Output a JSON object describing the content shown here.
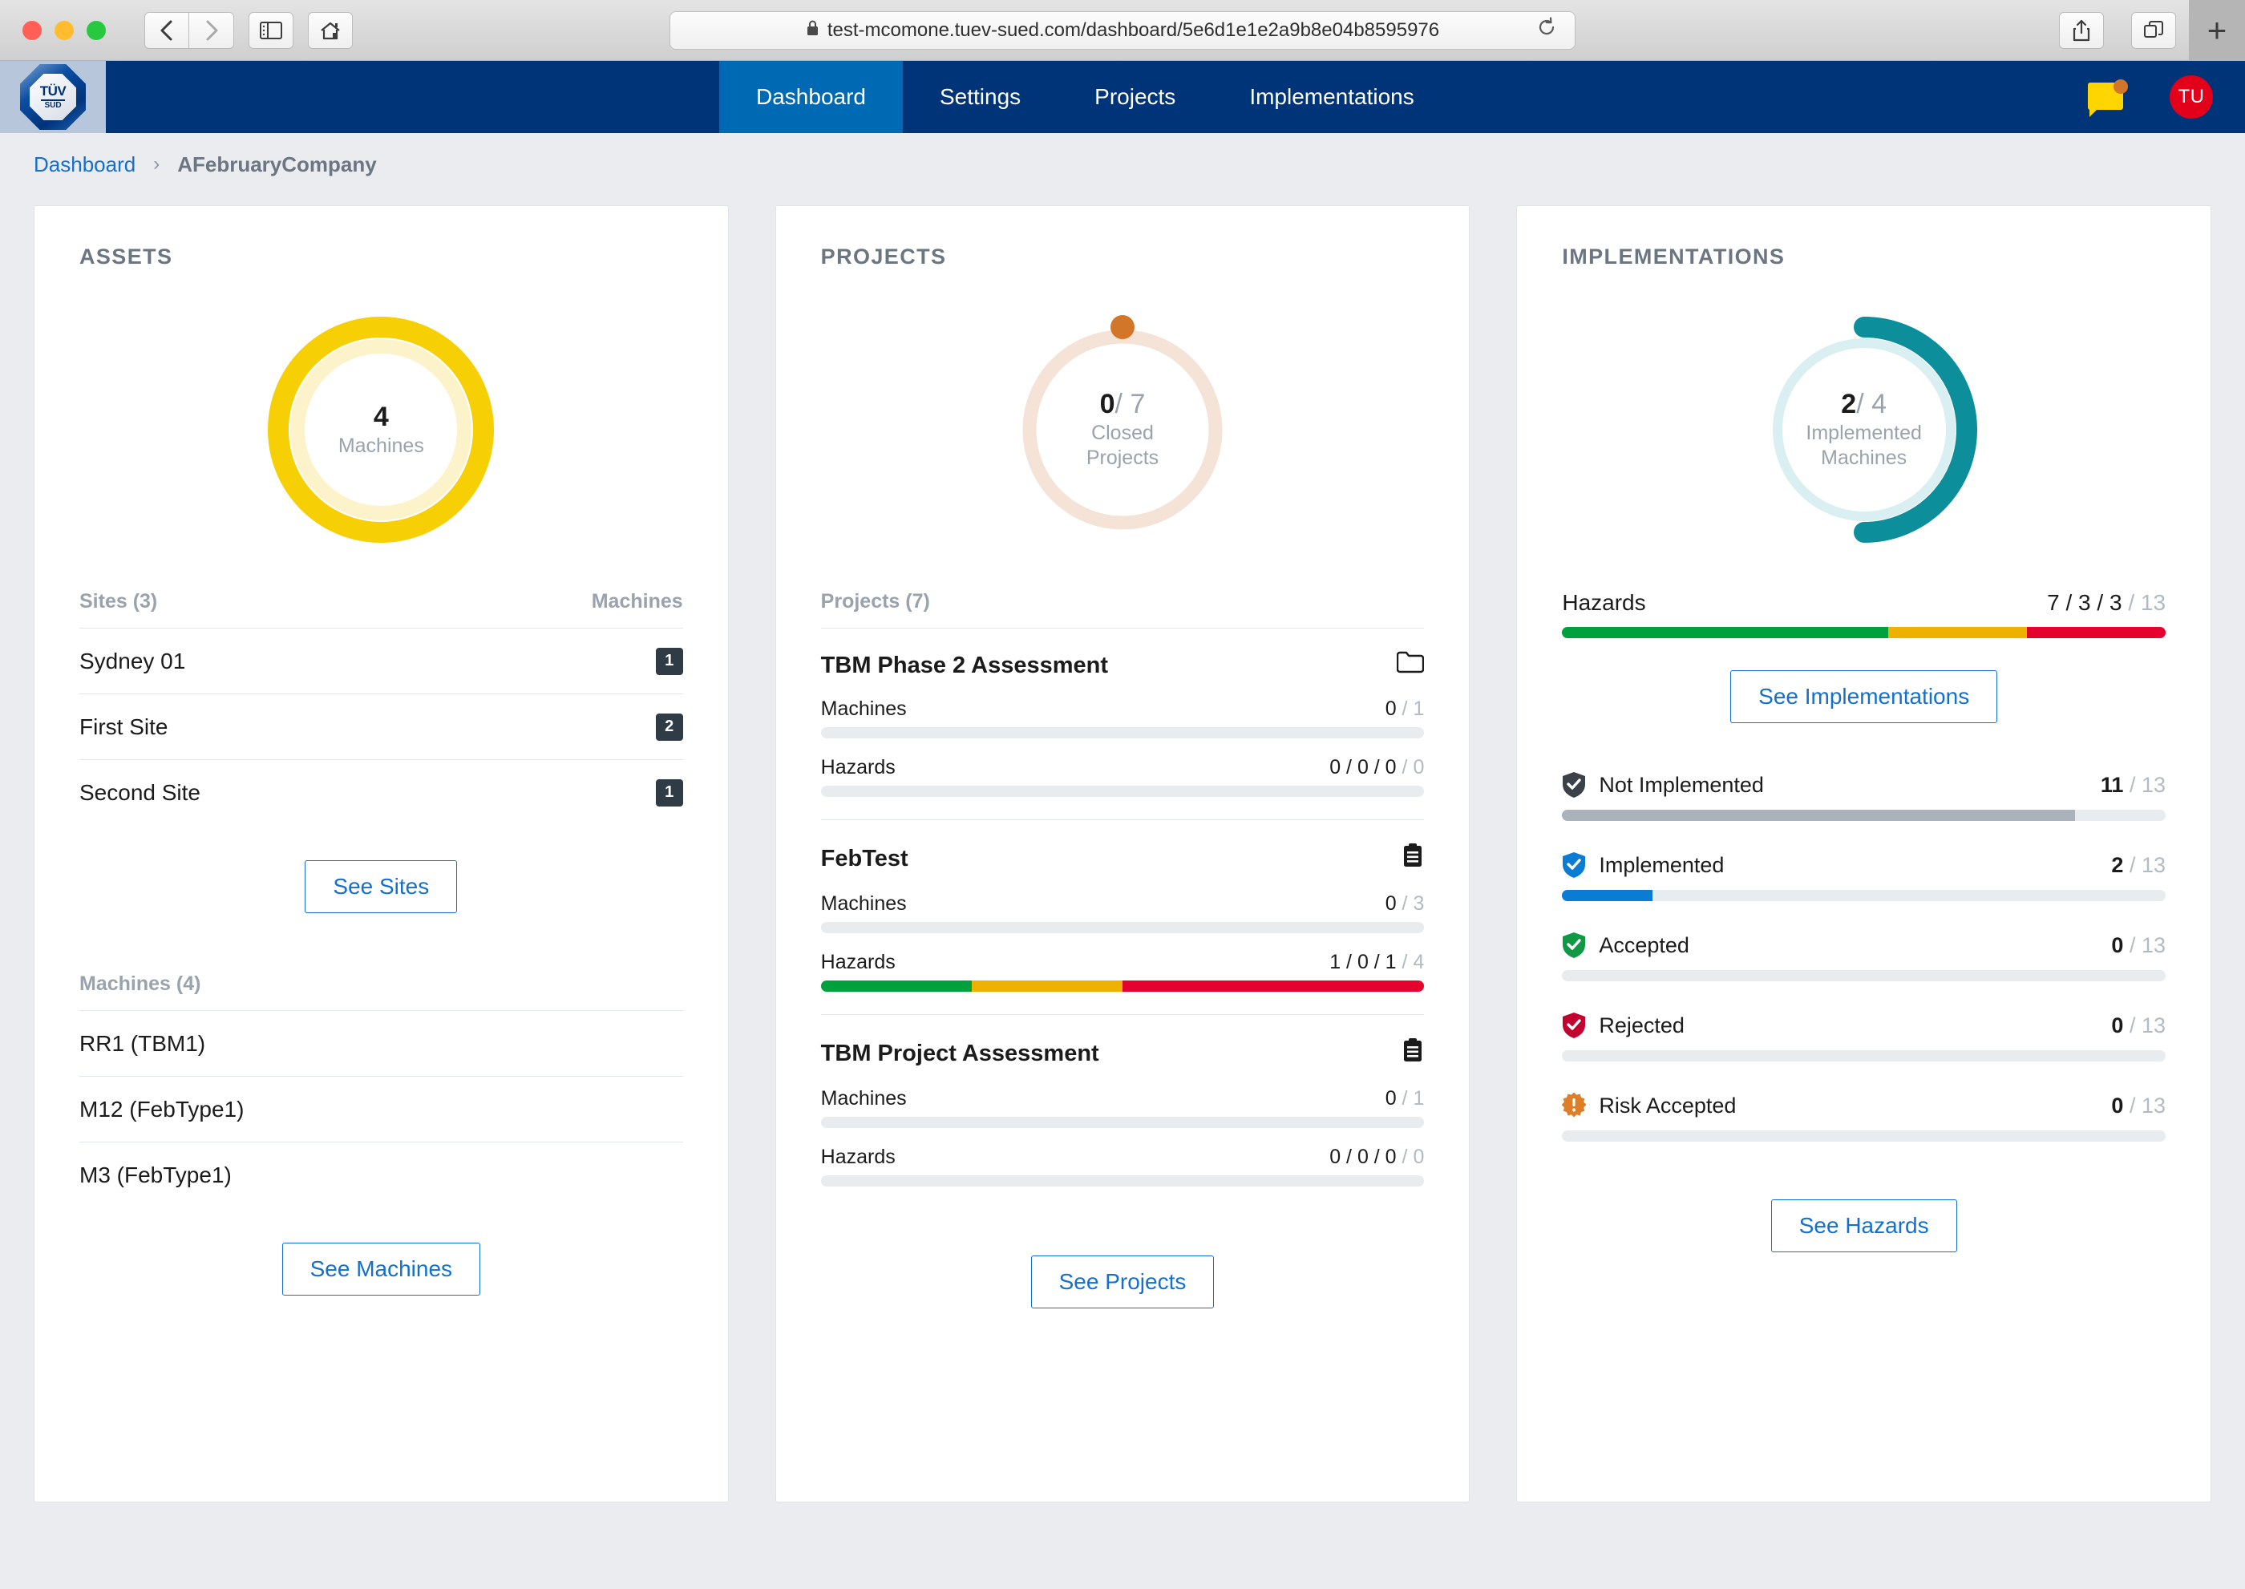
{
  "browser": {
    "url": "test-mcomone.tuev-sued.com/dashboard/5e6d1e1e2a9b8e04b8595976",
    "lock_icon": "lock-icon",
    "reload_icon": "reload-icon",
    "back_icon": "back-arrow-icon",
    "forward_icon": "forward-arrow-icon",
    "sidebar_icon": "sidebar-toggle-icon",
    "home_icon": "home-icon",
    "share_icon": "share-icon",
    "tabs_icon": "tab-overview-icon",
    "newtab_label": "+"
  },
  "header": {
    "logo": {
      "line1": "TÜV",
      "line2": "SÜD",
      "name": "tuv-sud-logo"
    },
    "tabs": [
      {
        "label": "Dashboard",
        "active": true
      },
      {
        "label": "Settings",
        "active": false
      },
      {
        "label": "Projects",
        "active": false
      },
      {
        "label": "Implementations",
        "active": false
      }
    ],
    "chat_icon": "chat-bubble-icon",
    "avatar_initials": "TU",
    "nav_bg": "#003478",
    "nav_active_bg": "#0069b4"
  },
  "breadcrumb": {
    "root": "Dashboard",
    "separator": "›",
    "current": "AFebruaryCompany"
  },
  "assets": {
    "title": "ASSETS",
    "donut": {
      "value": "4",
      "label": "Machines",
      "percent": 100,
      "color": "#f6cf04",
      "track_color": "#fdf3cb"
    },
    "sites_header_left": "Sites (3)",
    "sites_header_right": "Machines",
    "sites": [
      {
        "name": "Sydney 01",
        "machines": "1"
      },
      {
        "name": "First Site",
        "machines": "2"
      },
      {
        "name": "Second Site",
        "machines": "1"
      }
    ],
    "see_sites_label": "See Sites",
    "machines_header": "Machines (4)",
    "machines": [
      {
        "name": "RR1 (TBM1)"
      },
      {
        "name": "M12 (FebType1)"
      },
      {
        "name": "M3 (FebType1)"
      }
    ],
    "see_machines_label": "See Machines"
  },
  "projects": {
    "title": "PROJECTS",
    "donut": {
      "value": "0",
      "denominator": "/ 7",
      "label_line1": "Closed",
      "label_line2": "Projects",
      "percent": 0,
      "color": "#d2762a",
      "track_color": "#f4e3d6"
    },
    "list_header": "Projects (7)",
    "items": [
      {
        "name": "TBM Phase 2 Assessment",
        "icon": "folder-icon",
        "machines_label": "Machines",
        "machines_value": "0",
        "machines_total": "/ 1",
        "machines_percent": 0,
        "hazards_label": "Hazards",
        "hazards_value": "0 / 0 / 0",
        "hazards_total": "/ 0",
        "hazards_green": 0,
        "hazards_yellow": 0,
        "hazards_red": 0
      },
      {
        "name": "FebTest",
        "icon": "clipboard-icon",
        "machines_label": "Machines",
        "machines_value": "0",
        "machines_total": "/ 3",
        "machines_percent": 0,
        "hazards_label": "Hazards",
        "hazards_value": "1 / 0 / 1",
        "hazards_total": "/ 4",
        "hazards_green": 25,
        "hazards_yellow": 25,
        "hazards_red": 50
      },
      {
        "name": "TBM Project Assessment",
        "icon": "clipboard-icon",
        "machines_label": "Machines",
        "machines_value": "0",
        "machines_total": "/ 1",
        "machines_percent": 0,
        "hazards_label": "Hazards",
        "hazards_value": "0 / 0 / 0",
        "hazards_total": "/ 0",
        "hazards_green": 0,
        "hazards_yellow": 0,
        "hazards_red": 0
      }
    ],
    "see_projects_label": "See Projects"
  },
  "implementations": {
    "title": "IMPLEMENTATIONS",
    "donut": {
      "value": "2",
      "denominator": "/ 4",
      "label_line1": "Implemented",
      "label_line2": "Machines",
      "percent": 50,
      "color": "#0d8f9b",
      "track_color": "#d9eff1"
    },
    "hazards_label": "Hazards",
    "hazards_value": "7 / 3 / 3",
    "hazards_total": "/ 13",
    "hazards_green": 54,
    "hazards_yellow": 23,
    "hazards_red": 23,
    "see_implementations_label": "See Implementations",
    "statuses": [
      {
        "name": "Not Implemented",
        "icon": "shield-check-dark-icon",
        "color": "#3a4149",
        "bar_color": "#aab2bb",
        "value": "11",
        "total": "/ 13",
        "percent": 85
      },
      {
        "name": "Implemented",
        "icon": "shield-check-blue-icon",
        "color": "#0a7cd4",
        "bar_color": "#0a7cd4",
        "value": "2",
        "total": "/ 13",
        "percent": 15
      },
      {
        "name": "Accepted",
        "icon": "shield-check-green-icon",
        "color": "#109945",
        "bar_color": "#109945",
        "value": "0",
        "total": "/ 13",
        "percent": 0
      },
      {
        "name": "Rejected",
        "icon": "shield-check-red-icon",
        "color": "#c3002f",
        "bar_color": "#c3002f",
        "value": "0",
        "total": "/ 13",
        "percent": 0
      },
      {
        "name": "Risk Accepted",
        "icon": "risk-badge-icon",
        "color": "#dc7f28",
        "bar_color": "#dc7f28",
        "value": "0",
        "total": "/ 13",
        "percent": 0
      }
    ],
    "see_hazards_label": "See Hazards"
  },
  "colors": {
    "green": "#00a03c",
    "yellow": "#efb100",
    "red": "#e4032e",
    "track": "#e9ecef",
    "link": "#1470cc"
  }
}
